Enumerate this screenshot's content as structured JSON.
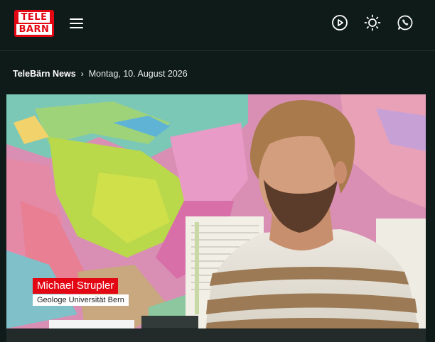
{
  "header": {
    "logo_line1": "TELE",
    "logo_line2": "BÄRN",
    "menu_icon": "hamburger-menu-icon",
    "actions": [
      {
        "icon": "play-circle-icon",
        "label": "Play"
      },
      {
        "icon": "sun-icon",
        "label": "Theme"
      },
      {
        "icon": "whatsapp-icon",
        "label": "WhatsApp"
      }
    ]
  },
  "breadcrumb": {
    "home": "TeleBärn News",
    "separator_icon": "chevron-right-icon",
    "date": "Montag, 10. August 2026"
  },
  "video": {
    "lower_third_name": "Michael Strupler",
    "lower_third_role": "Geologe Universität Bern"
  },
  "colors": {
    "background": "#0f1b19",
    "brand_red": "#e30613",
    "text": "#ffffff"
  }
}
